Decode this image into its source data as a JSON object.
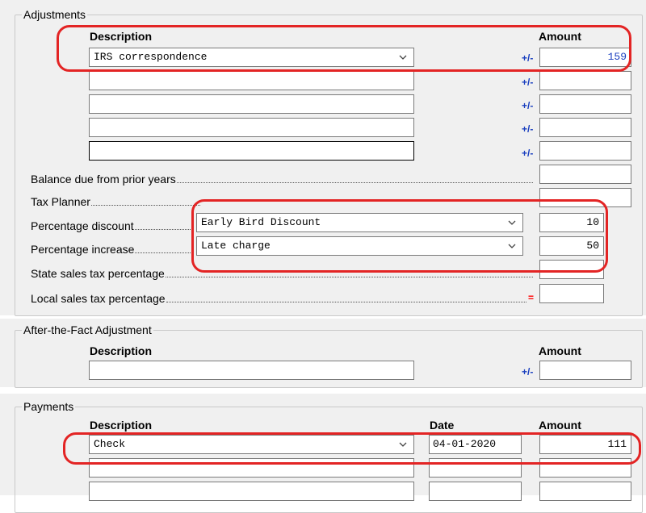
{
  "adjustments": {
    "title": "Adjustments",
    "description_header": "Description",
    "amount_header": "Amount",
    "rows": [
      {
        "description": "IRS correspondence",
        "amount": "159",
        "sign": "+/-"
      },
      {
        "description": "",
        "amount": "",
        "sign": "+/-"
      },
      {
        "description": "",
        "amount": "",
        "sign": "+/-"
      },
      {
        "description": "",
        "amount": "",
        "sign": "+/-"
      },
      {
        "description": "",
        "amount": "",
        "sign": "+/-"
      }
    ],
    "balance_due_label": "Balance due from prior years",
    "tax_planner_label": "Tax Planner",
    "percentage_discount": {
      "label": "Percentage discount",
      "selection": "Early Bird Discount",
      "value": "10"
    },
    "percentage_increase": {
      "label": "Percentage increase",
      "selection": "Late charge",
      "value": "50"
    },
    "state_sales_tax_label": "State sales tax percentage",
    "local_sales_tax_label": "Local sales tax percentage",
    "total_marker": "="
  },
  "after_fact": {
    "title": "After-the-Fact Adjustment",
    "description_header": "Description",
    "amount_header": "Amount",
    "sign": "+/-",
    "description": "",
    "amount": ""
  },
  "payments": {
    "title": "Payments",
    "description_header": "Description",
    "date_header": "Date",
    "amount_header": "Amount",
    "rows": [
      {
        "description": "Check",
        "date": "04-01-2020",
        "amount": "111"
      },
      {
        "description": "",
        "date": "",
        "amount": ""
      },
      {
        "description": "",
        "date": "",
        "amount": ""
      }
    ]
  },
  "colors": {
    "panel_bg": "#f0f0f0",
    "sign_blue": "#1a3fbf",
    "amount_blue": "#1a3fbf",
    "highlight_red": "#e32424",
    "equals_red": "#ff0000"
  },
  "icons": {
    "dropdown": "chevron-down-icon"
  }
}
